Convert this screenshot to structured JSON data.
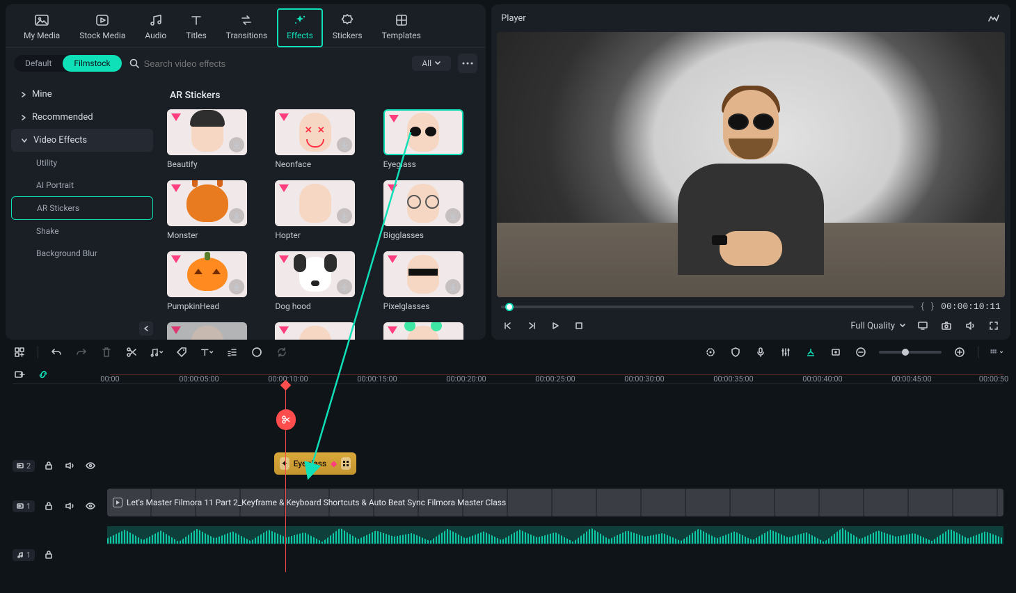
{
  "nav": {
    "tabs": [
      {
        "label": "My Media",
        "icon": "picture"
      },
      {
        "label": "Stock Media",
        "icon": "play-box"
      },
      {
        "label": "Audio",
        "icon": "music"
      },
      {
        "label": "Titles",
        "icon": "title"
      },
      {
        "label": "Transitions",
        "icon": "swap"
      },
      {
        "label": "Effects",
        "icon": "sparkle",
        "active": true
      },
      {
        "label": "Stickers",
        "icon": "badge"
      },
      {
        "label": "Templates",
        "icon": "layout"
      }
    ]
  },
  "tabs_pill": {
    "default": "Default",
    "filmstock": "Filmstock"
  },
  "search": {
    "placeholder": "Search video effects"
  },
  "filter": {
    "label": "All"
  },
  "sidebar": {
    "mine": "Mine",
    "recommended": "Recommended",
    "video_effects": "Video Effects",
    "sub": {
      "utility": "Utility",
      "ai_portrait": "AI Portrait",
      "ar_stickers": "AR Stickers",
      "shake": "Shake",
      "background_blur": "Background Blur"
    }
  },
  "section": {
    "title": "AR Stickers"
  },
  "cards": {
    "beautify": "Beautify",
    "neonface": "Neonface",
    "eyeglass": "Eyeglass",
    "monster": "Monster",
    "hopter": "Hopter",
    "bigglasses": "Bigglasses",
    "pumpkinhead": "PumpkinHead",
    "dog_hood": "Dog hood",
    "pixelglasses": "Pixelglasses"
  },
  "player": {
    "title": "Player",
    "time": "00:00:10:11",
    "quality": "Full Quality"
  },
  "ruler": {
    "marks": [
      "00:00",
      "00:00:05:00",
      "00:00:10:00",
      "00:00:15:00",
      "00:00:20:00",
      "00:00:25:00",
      "00:00:30:00",
      "00:00:35:00",
      "00:00:40:00",
      "00:00:45:00",
      "00:00:50"
    ]
  },
  "tracks": {
    "fx_label": "2",
    "v_label": "1",
    "a_label": "1"
  },
  "effect_clip": {
    "label": "Eyeglass"
  },
  "video_clip": {
    "title": "Let's Master Filmora 11 Part 2_Keyframe & Keyboard Shortcuts & Auto Beat Sync   Filmora Master Class"
  }
}
